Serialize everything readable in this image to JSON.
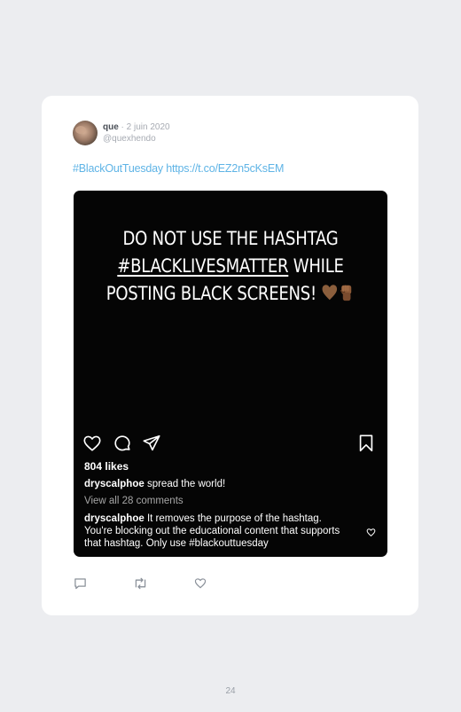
{
  "tweet": {
    "display_name": "que",
    "date": " · 2 juin 2020",
    "handle": "@quexhendo",
    "text": "#BlackOutTuesday https://t.co/EZ2n5cKsEM"
  },
  "instagram_post": {
    "headline_line1": "DO NOT USE THE HASHTAG",
    "headline_tag": "#BLACKLIVESMATTER",
    "headline_line2_rest": " WHILE",
    "headline_line3": "POSTING BLACK SCREENS! ",
    "emojis": [
      "brown-heart-icon",
      "raised-fist-icon"
    ],
    "likes": "804 likes",
    "caption_user": "dryscalphoe",
    "caption_text": " spread the world!",
    "view_all": "View all 28 comments",
    "comment_user": "dryscalphoe",
    "comment_text": " It removes the purpose of the hashtag. You're blocking out the educational content that supports that hashtag. Only use #blackouttuesday"
  },
  "page_number": "24",
  "colors": {
    "background": "#ecedf0",
    "card": "#ffffff",
    "link": "#5fb4e6",
    "post_bg": "#050505",
    "icon_gray": "#8a9099"
  }
}
